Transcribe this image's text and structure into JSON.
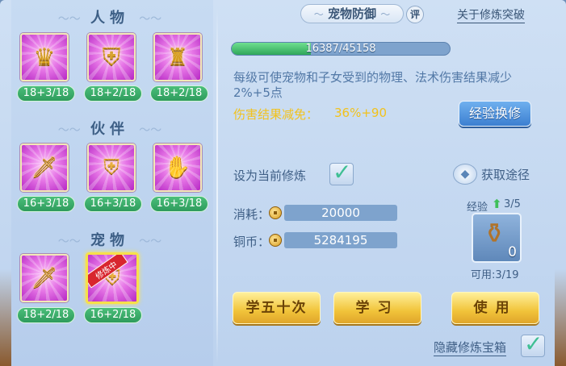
{
  "left": {
    "sections": [
      {
        "title": "人物",
        "skills": [
          {
            "icon": "meditating-figure-icon",
            "level": "18+3/18"
          },
          {
            "icon": "armor-shield-icon",
            "level": "18+2/18"
          },
          {
            "icon": "warrior-figure-icon",
            "level": "18+2/18"
          }
        ]
      },
      {
        "title": "伙伴",
        "skills": [
          {
            "icon": "lion-sword-icon",
            "level": "16+3/18"
          },
          {
            "icon": "lion-shield-icon",
            "level": "16+3/18"
          },
          {
            "icon": "lion-gauntlet-icon",
            "level": "16+3/18"
          }
        ]
      },
      {
        "title": "宠物",
        "skills": [
          {
            "icon": "cat-sword-icon",
            "level": "18+2/18"
          },
          {
            "icon": "cat-shield-icon",
            "level": "16+2/18",
            "badge": "修炼中",
            "selected": true
          }
        ]
      }
    ]
  },
  "right": {
    "title": "宠物防御",
    "review_label": "评",
    "about_link": "关于修炼突破",
    "progress": {
      "text": "16387/45158",
      "fraction": 0.363
    },
    "description": "每级可使宠物和子女受到的物理、法术伤害结果减少2%+5点",
    "reduction_label": "伤害结果减免：",
    "reduction_value": "36%+90",
    "exchange_button": "经验换修",
    "set_current_label": "设为当前修炼",
    "set_current_checked": true,
    "obtain_link": "获取途径",
    "cost_label": "消耗：",
    "cost_value": "20000",
    "coins_label": "铜币：",
    "coins_value": "5284195",
    "exp_label": "经验",
    "exp_count": "3/5",
    "item_qty": "0",
    "available": "可用:3/19",
    "btn_learn_fifty": "学五十次",
    "btn_learn": "学习",
    "btn_use": "使用",
    "hide_label": "隐藏修炼宝箱",
    "hide_checked": true
  }
}
